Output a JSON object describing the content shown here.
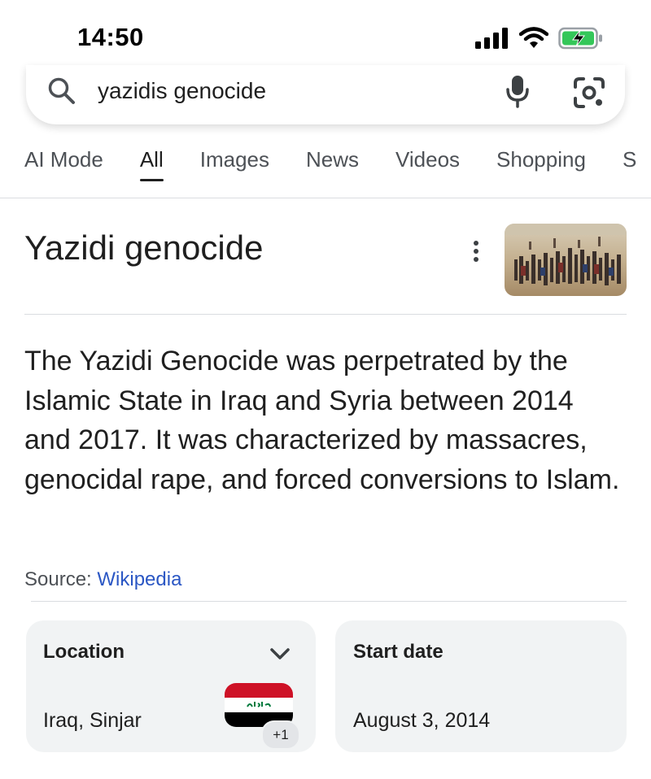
{
  "status_bar": {
    "time": "14:50",
    "icons": [
      "cellular-signal-icon",
      "wifi-icon",
      "battery-charging-icon"
    ]
  },
  "search": {
    "query": "yazidis genocide",
    "icons": [
      "search-icon",
      "mic-icon",
      "google-lens-icon"
    ]
  },
  "tabs": [
    {
      "label": "AI Mode",
      "active": false
    },
    {
      "label": "All",
      "active": true
    },
    {
      "label": "Images",
      "active": false
    },
    {
      "label": "News",
      "active": false
    },
    {
      "label": "Videos",
      "active": false
    },
    {
      "label": "Shopping",
      "active": false
    },
    {
      "label": "S",
      "active": false
    }
  ],
  "knowledge_panel": {
    "title": "Yazidi genocide",
    "description": "The Yazidi Genocide was perpetrated by the Islamic State in Iraq and Syria between 2014 and 2017. It was characterized by massacres, genocidal rape, and forced conversions to Islam.",
    "source_label": "Source:",
    "source_link": "Wikipedia",
    "facts": {
      "location": {
        "label": "Location",
        "value": "Iraq, Sinjar",
        "badge": "+1"
      },
      "start_date": {
        "label": "Start date",
        "value": "August 3, 2014"
      }
    }
  },
  "colors": {
    "link": "#2b57c4",
    "card_bg": "#f1f3f4",
    "flag_red": "#ce1126",
    "flag_white": "#ffffff",
    "flag_black": "#000000",
    "flag_green": "#007a3d"
  }
}
